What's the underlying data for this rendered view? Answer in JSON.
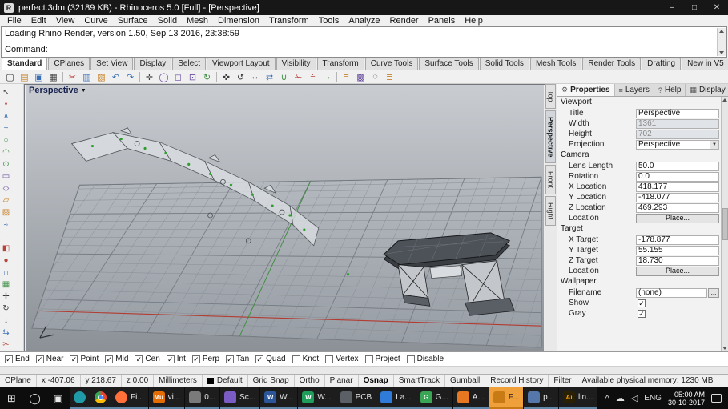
{
  "colors": {
    "accent_flash": "#efa03a",
    "axis_x": "#b23b32",
    "axis_y": "#3f8f3f",
    "point_green": "#2f9e2f",
    "viewport_bg_top": "#c9ccd1",
    "viewport_bg_bottom": "#8b9197",
    "taskbar_bg": "#0d0d0d"
  },
  "window": {
    "title": "perfect.3dm (32189 KB) - Rhinoceros 5.0 [Full] - [Perspective]",
    "minimize": "–",
    "maximize": "□",
    "close": "✕"
  },
  "menu": [
    "File",
    "Edit",
    "View",
    "Curve",
    "Surface",
    "Solid",
    "Mesh",
    "Dimension",
    "Transform",
    "Tools",
    "Analyze",
    "Render",
    "Panels",
    "Help"
  ],
  "command_area": {
    "history": "Loading Rhino Render, version 1.50, Sep 13 2016, 23:38:59",
    "prompt": "Command:",
    "input_value": ""
  },
  "tabs": [
    "Standard",
    "CPlanes",
    "Set View",
    "Display",
    "Select",
    "Viewport Layout",
    "Visibility",
    "Transform",
    "Curve Tools",
    "Surface Tools",
    "Solid Tools",
    "Mesh Tools",
    "Render Tools",
    "Drafting",
    "New in V5"
  ],
  "active_tab": "Standard",
  "ttb": [
    {
      "name": "new-file",
      "glyph": "▢"
    },
    {
      "name": "open-file",
      "glyph": "▤"
    },
    {
      "name": "save-file",
      "glyph": "▣"
    },
    {
      "name": "print",
      "glyph": "▦"
    },
    {
      "name": "cut",
      "glyph": "✂"
    },
    {
      "name": "copy",
      "glyph": "▥"
    },
    {
      "name": "paste",
      "glyph": "▧"
    },
    {
      "name": "undo",
      "glyph": "↶"
    },
    {
      "name": "redo",
      "glyph": "↷"
    },
    {
      "name": "pan",
      "glyph": "✛"
    },
    {
      "name": "zoom",
      "glyph": "◯"
    },
    {
      "name": "zoom-window",
      "glyph": "◻"
    },
    {
      "name": "zoom-extents",
      "glyph": "⊡"
    },
    {
      "name": "rotate-view",
      "glyph": "↻"
    },
    {
      "name": "move",
      "glyph": "✜"
    },
    {
      "name": "rotate",
      "glyph": "↺"
    },
    {
      "name": "scale",
      "glyph": "↔"
    },
    {
      "name": "mirror",
      "glyph": "⇄"
    },
    {
      "name": "join",
      "glyph": "∪"
    },
    {
      "name": "trim",
      "glyph": "✁"
    },
    {
      "name": "split",
      "glyph": "÷"
    },
    {
      "name": "extend",
      "glyph": "→"
    },
    {
      "name": "offset",
      "glyph": "≡"
    },
    {
      "name": "array",
      "glyph": "▩"
    },
    {
      "name": "hide",
      "glyph": "◌"
    },
    {
      "name": "layers",
      "glyph": "≣"
    }
  ],
  "ltb": [
    {
      "name": "pointer",
      "glyph": "↖"
    },
    {
      "name": "point",
      "glyph": "•"
    },
    {
      "name": "polyline",
      "glyph": "∧"
    },
    {
      "name": "curve",
      "glyph": "~"
    },
    {
      "name": "circle",
      "glyph": "○"
    },
    {
      "name": "arc",
      "glyph": "◠"
    },
    {
      "name": "ellipse",
      "glyph": "⊙"
    },
    {
      "name": "rectangle",
      "glyph": "▭"
    },
    {
      "name": "polygon",
      "glyph": "◇"
    },
    {
      "name": "plane",
      "glyph": "▱"
    },
    {
      "name": "surface",
      "glyph": "▨"
    },
    {
      "name": "loft",
      "glyph": "≈"
    },
    {
      "name": "extrude",
      "glyph": "↑"
    },
    {
      "name": "box",
      "glyph": "◧"
    },
    {
      "name": "sphere",
      "glyph": "●"
    },
    {
      "name": "boolean",
      "glyph": "∩"
    },
    {
      "name": "mesh",
      "glyph": "▦"
    },
    {
      "name": "move",
      "glyph": "✛"
    },
    {
      "name": "rotate",
      "glyph": "↻"
    },
    {
      "name": "scale",
      "glyph": "↕"
    },
    {
      "name": "mirror",
      "glyph": "⇆"
    },
    {
      "name": "trim",
      "glyph": "✂"
    },
    {
      "name": "fillet",
      "glyph": "◡"
    },
    {
      "name": "dimension",
      "glyph": "↔"
    }
  ],
  "viewport": {
    "label": "Perspective"
  },
  "side_tabs": [
    "Top",
    "Perspective",
    "Front",
    "Right"
  ],
  "active_side_tab": "Perspective",
  "panel": {
    "tabs": [
      {
        "label": "Properties",
        "icon": "⚙"
      },
      {
        "label": "Layers",
        "icon": "≡"
      },
      {
        "label": "Help",
        "icon": "?"
      },
      {
        "label": "Display",
        "icon": "▦"
      }
    ],
    "active_tab": "Properties",
    "sections": [
      {
        "title": "Viewport",
        "rows": [
          {
            "label": "Title",
            "value": "Perspective"
          },
          {
            "label": "Width",
            "value": "1361"
          },
          {
            "label": "Height",
            "value": "702"
          },
          {
            "label": "Projection",
            "value": "Perspective"
          }
        ]
      },
      {
        "title": "Camera",
        "rows": [
          {
            "label": "Lens Length",
            "value": "50.0"
          },
          {
            "label": "Rotation",
            "value": "0.0"
          },
          {
            "label": "X Location",
            "value": "418.177"
          },
          {
            "label": "Y Location",
            "value": "-418.077"
          },
          {
            "label": "Z Location",
            "value": "469.293"
          },
          {
            "label": "Location",
            "value": "Place..."
          }
        ]
      },
      {
        "title": "Target",
        "rows": [
          {
            "label": "X Target",
            "value": "-178.877"
          },
          {
            "label": "Y Target",
            "value": "55.155"
          },
          {
            "label": "Z Target",
            "value": "18.730"
          },
          {
            "label": "Location",
            "value": "Place..."
          }
        ]
      },
      {
        "title": "Wallpaper",
        "rows": [
          {
            "label": "Filename",
            "value": "(none)",
            "browse": "..."
          },
          {
            "label": "Show",
            "check": "✓"
          },
          {
            "label": "Gray",
            "check": "✓"
          }
        ]
      }
    ]
  },
  "osnap": [
    {
      "label": "End",
      "check": "✓"
    },
    {
      "label": "Near",
      "check": "✓"
    },
    {
      "label": "Point",
      "check": "✓"
    },
    {
      "label": "Mid",
      "check": "✓"
    },
    {
      "label": "Cen",
      "check": "✓"
    },
    {
      "label": "Int",
      "check": "✓"
    },
    {
      "label": "Perp",
      "check": "✓"
    },
    {
      "label": "Tan",
      "check": "✓"
    },
    {
      "label": "Quad",
      "check": "✓"
    },
    {
      "label": "Knot",
      "check": ""
    },
    {
      "label": "Vertex",
      "check": ""
    },
    {
      "label": "Project",
      "check": ""
    },
    {
      "label": "Disable",
      "check": ""
    }
  ],
  "status": [
    "CPlane",
    "x -407.06",
    "y 218.67",
    "z 0.00",
    "Millimeters",
    "Default",
    "Grid Snap",
    "Ortho",
    "Planar",
    "Osnap",
    "SmartTrack",
    "Gumball",
    "Record History",
    "Filter",
    "Available physical memory: 1230 MB"
  ],
  "taskbar": {
    "start": "⊞",
    "search": "◯",
    "taskview": "▣",
    "apps": [
      {
        "name": "media-app",
        "label": "",
        "color": "#1f9aa8"
      },
      {
        "name": "chrome",
        "label": "",
        "color": "#ea4335"
      },
      {
        "name": "firefox",
        "label": "Fi...",
        "color": "#ff7139"
      },
      {
        "name": "mu-app",
        "label": "vi...",
        "icon_text": "Mu",
        "color": "#e46c00"
      },
      {
        "name": "app-0",
        "label": "0...",
        "color": "#7a7a7a"
      },
      {
        "name": "app-sc",
        "label": "Sc...",
        "color": "#7a5cc4"
      },
      {
        "name": "word",
        "label": "W...",
        "icon_text": "W",
        "color": "#2b579a"
      },
      {
        "name": "app-w2",
        "label": "W...",
        "icon_text": "W",
        "color": "#1e9e5a"
      },
      {
        "name": "pcb-app",
        "label": "PCB",
        "color": "#5b5f66"
      },
      {
        "name": "app-la",
        "label": "La...",
        "color": "#2f7bd9"
      },
      {
        "name": "app-g",
        "label": "G...",
        "icon_text": "G",
        "color": "#3aa655"
      },
      {
        "name": "app-a",
        "label": "A...",
        "color": "#e87722"
      },
      {
        "name": "app-f-flash",
        "label": "F...",
        "color": "#c87b15",
        "flash": true
      },
      {
        "name": "app-p",
        "label": "p...",
        "color": "#5577aa"
      },
      {
        "name": "illustrator",
        "label": "lin...",
        "icon_text": "Ai",
        "color": "#2a2105"
      }
    ],
    "tray": {
      "expand": "^",
      "cloud": "☁",
      "speaker": "◁",
      "lang": "ENG",
      "time": "05:00 AM",
      "date": "30-10-2017"
    }
  }
}
